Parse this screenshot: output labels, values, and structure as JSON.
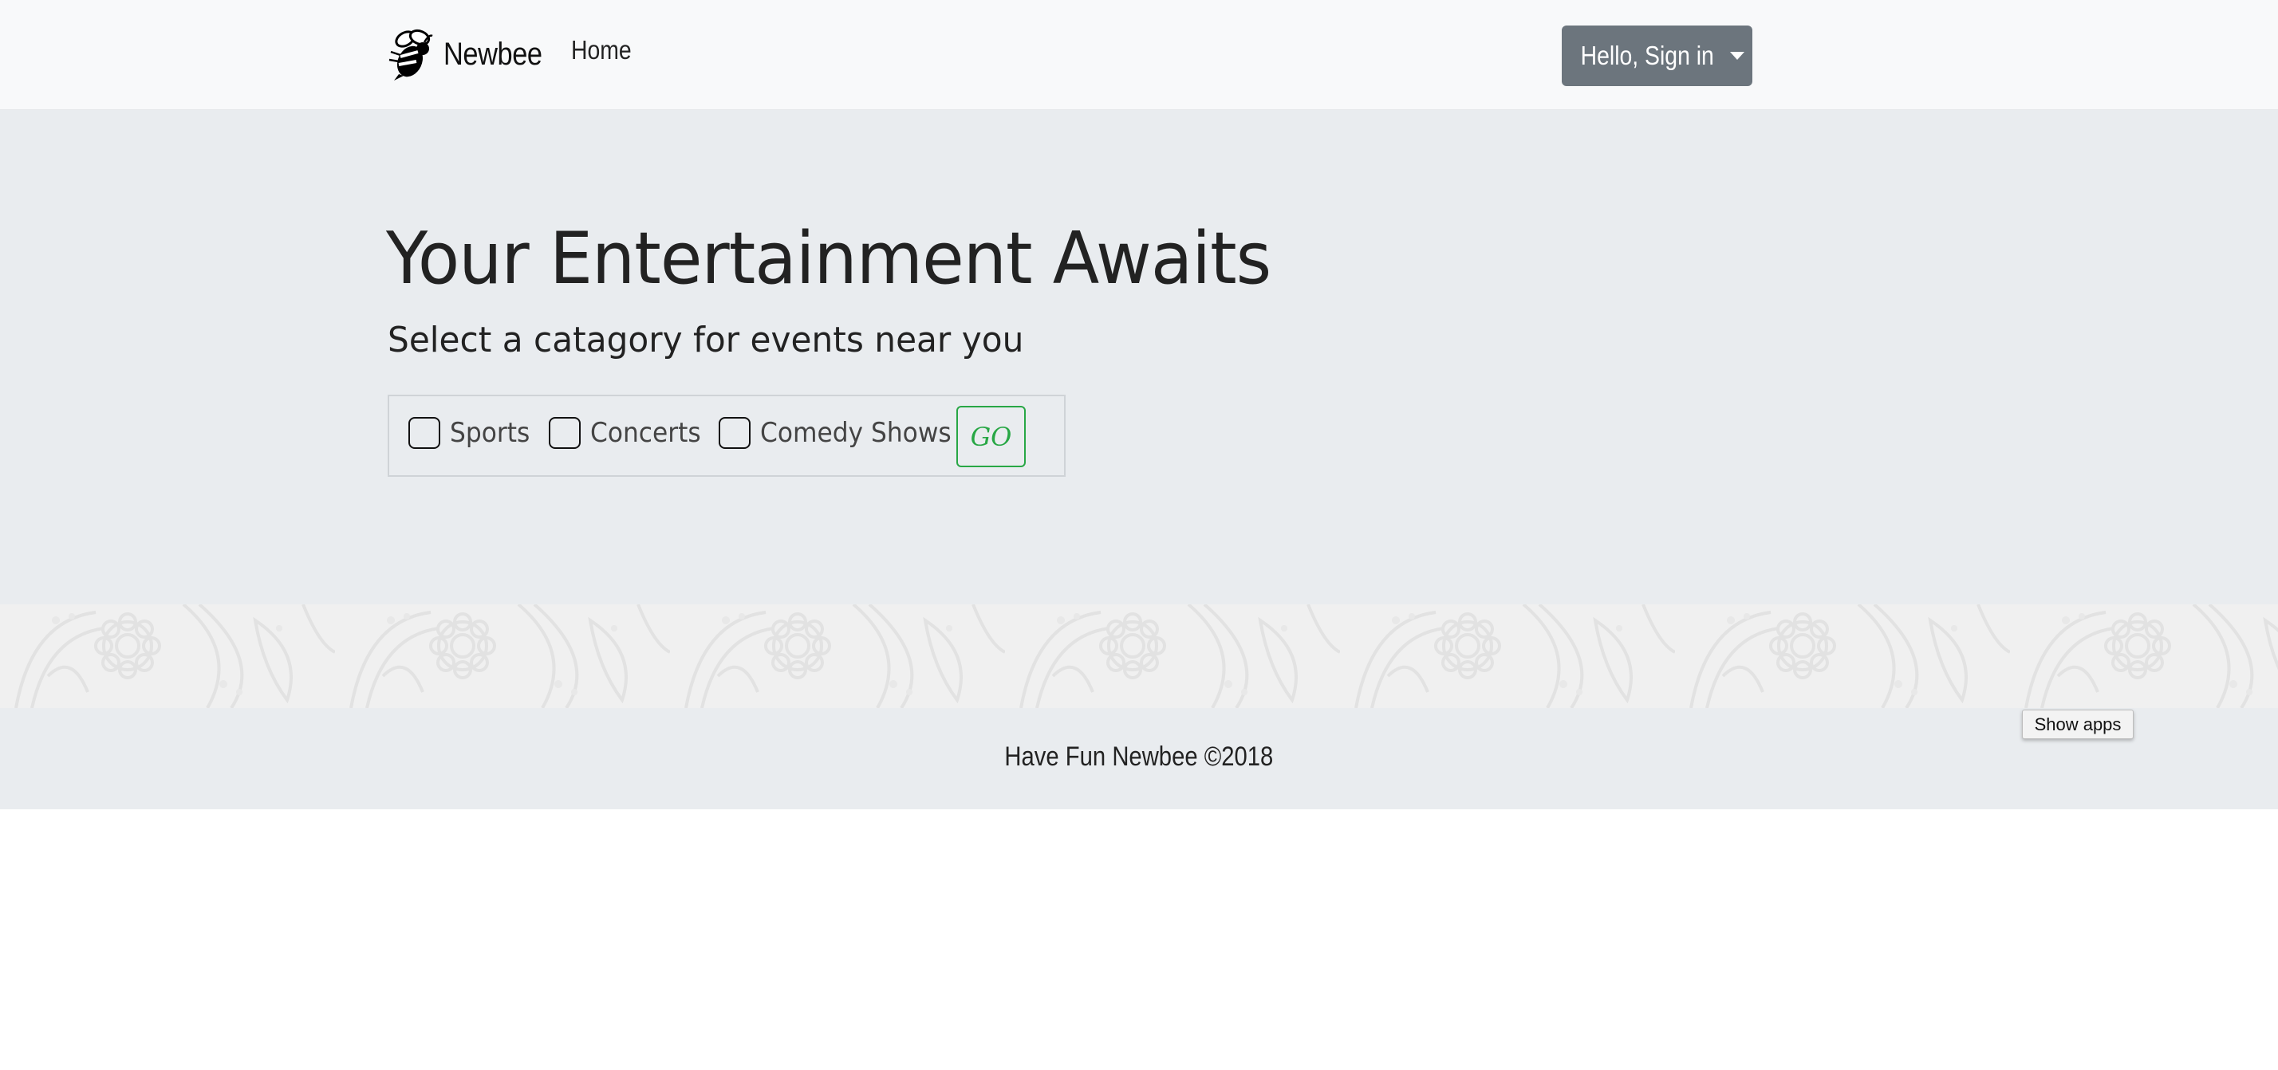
{
  "navbar": {
    "brand_name": "Newbee",
    "brand_icon": "bee-icon",
    "home_link": "Home",
    "signin_label": "Hello, Sign in",
    "signin_icon": "caret-down-icon"
  },
  "jumbotron": {
    "headline": "Your Entertainment Awaits",
    "subheading": "Select a catagory for events near you",
    "categories": [
      {
        "label": "Sports",
        "checked": false
      },
      {
        "label": "Concerts",
        "checked": false
      },
      {
        "label": "Comedy Shows",
        "checked": false
      }
    ],
    "go_label": "GO"
  },
  "footer": {
    "text": "Have Fun Newbee ©2018"
  },
  "overlay": {
    "show_apps_label": "Show apps"
  },
  "colors": {
    "navbar_bg": "#f8f9fa",
    "jumbotron_bg": "#e9ecef",
    "signin_bg": "#6c757d",
    "go_accent": "#28a745",
    "footer_bg": "#e9ecef"
  }
}
